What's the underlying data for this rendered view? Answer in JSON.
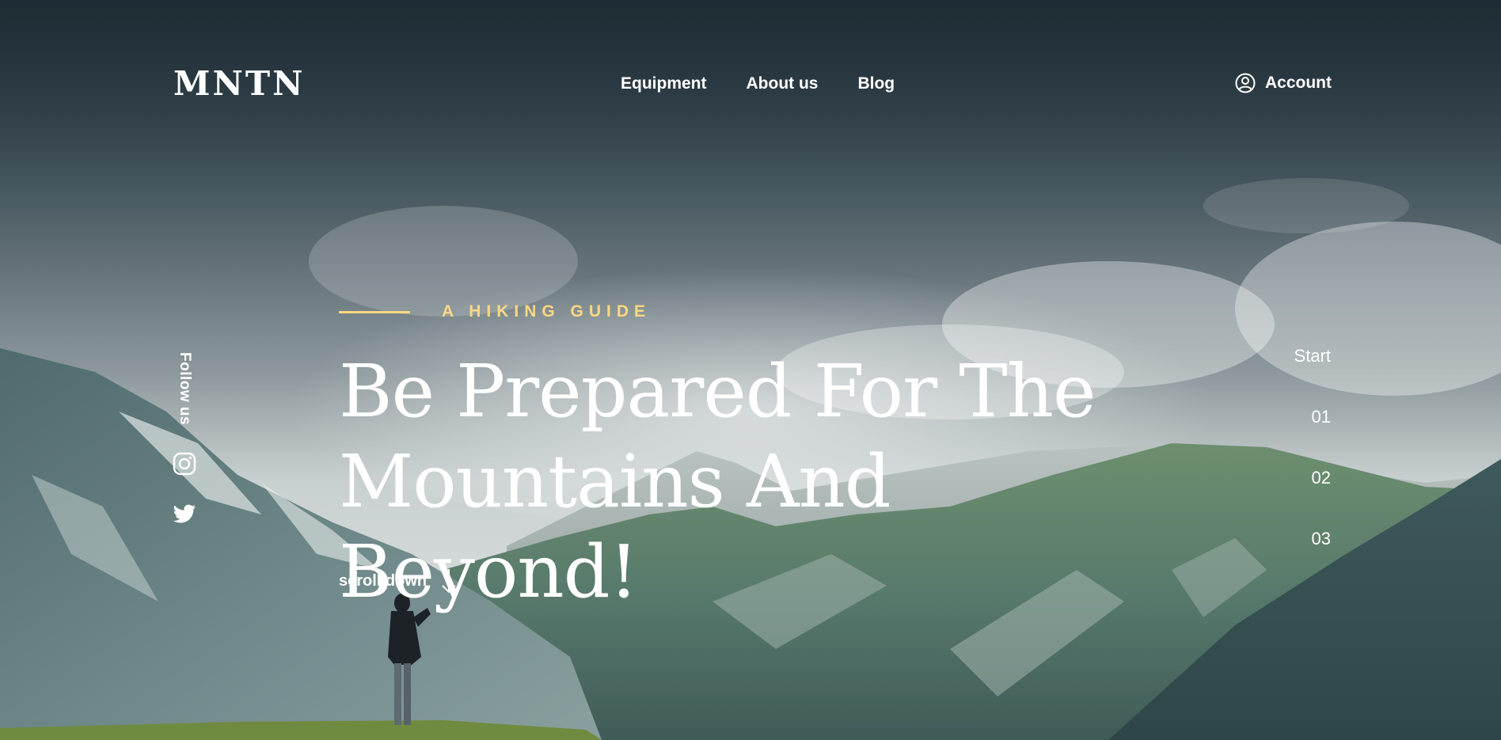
{
  "brand": {
    "logo": "MNTN"
  },
  "nav": {
    "items": [
      {
        "label": "Equipment"
      },
      {
        "label": "About us"
      },
      {
        "label": "Blog"
      }
    ],
    "account_label": "Account",
    "account_icon": "user-circle-icon"
  },
  "social": {
    "follow_label": "Follow us",
    "icons": [
      "instagram-icon",
      "twitter-icon"
    ]
  },
  "hero": {
    "eyebrow": "A HIKING GUIDE",
    "headline_line1": "Be Prepared For The",
    "headline_line2": "Mountains And Beyond!",
    "scroll_label": "scroll down",
    "scroll_icon": "arrow-down-icon"
  },
  "pager": {
    "items": [
      "Start",
      "01",
      "02",
      "03"
    ]
  },
  "colors": {
    "accent": "#FBD784",
    "text": "#FFFFFF",
    "sky_top": "#1F2E36",
    "sky_mid": "#5E7078",
    "mountain": "#4B6A62",
    "grass": "#6E8F48"
  }
}
